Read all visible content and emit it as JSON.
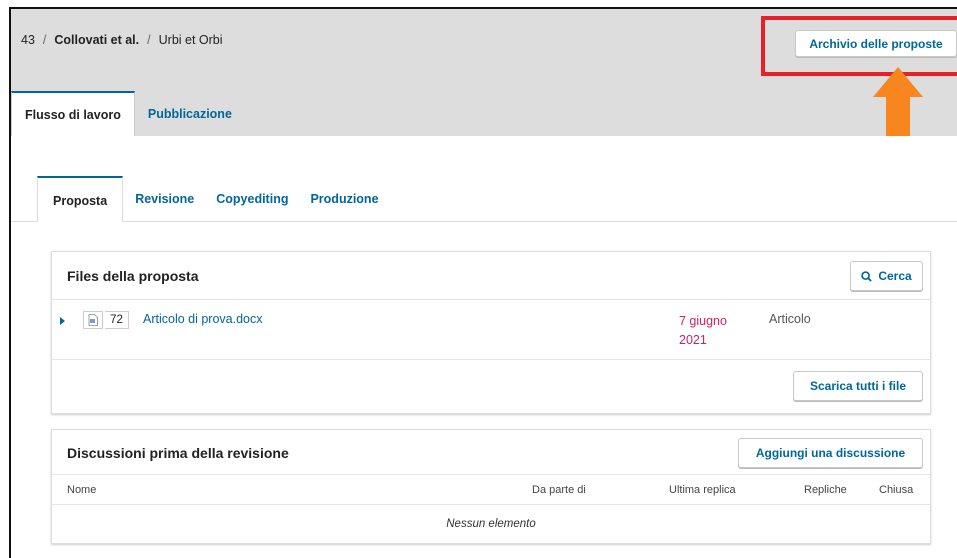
{
  "breadcrumb": {
    "id": "43",
    "separator": "/",
    "authors": "Collovati et al.",
    "title": "Urbi et Orbi"
  },
  "header": {
    "archive_button": "Archivio delle proposte"
  },
  "colors": {
    "link": "#006798",
    "date": "#c9226b",
    "highlight": "#e8202a",
    "arrow": "#f7861f"
  },
  "main_tabs": [
    {
      "label": "Flusso di lavoro",
      "active": true
    },
    {
      "label": "Pubblicazione",
      "active": false
    }
  ],
  "sub_tabs": [
    {
      "label": "Proposta",
      "active": true
    },
    {
      "label": "Revisione",
      "active": false
    },
    {
      "label": "Copyediting",
      "active": false
    },
    {
      "label": "Produzione",
      "active": false
    }
  ],
  "files_panel": {
    "title": "Files della proposta",
    "search_button": "Cerca",
    "search_icon": "search-icon",
    "file": {
      "icon": "word-doc-icon",
      "id": "72",
      "name": "Articolo di prova.docx",
      "date": "7 giugno 2021",
      "type": "Articolo"
    },
    "download_all_button": "Scarica tutti i file"
  },
  "discussions_panel": {
    "title": "Discussioni prima della revisione",
    "add_button": "Aggiungi una discussione",
    "columns": [
      "Nome",
      "Da parte di",
      "Ultima replica",
      "Repliche",
      "Chiusa"
    ],
    "empty_text": "Nessun elemento"
  }
}
